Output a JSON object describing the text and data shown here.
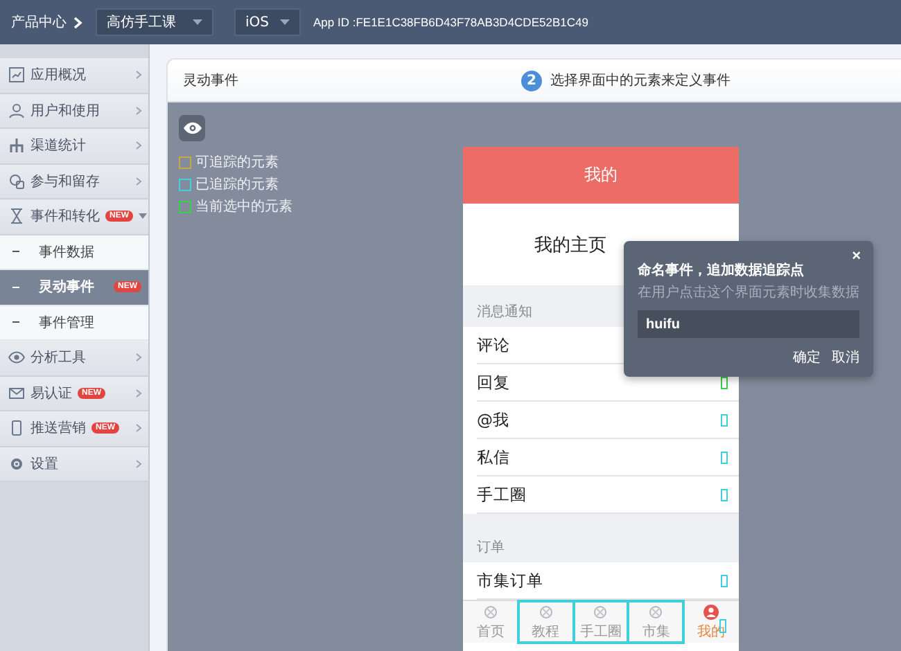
{
  "topbar": {
    "breadcrumb": "产品中心",
    "app_select": "高仿手工课",
    "platform_select": "iOS",
    "app_id": "App ID :FE1E1C38FB6D43F78AB3D4CDE52B1C49"
  },
  "sidebar": {
    "items": [
      {
        "label": "应用概况",
        "expanded": false
      },
      {
        "label": "用户和使用",
        "expanded": false
      },
      {
        "label": "渠道统计",
        "expanded": false
      },
      {
        "label": "参与和留存",
        "expanded": false
      },
      {
        "label": "事件和转化",
        "badge": "NEW",
        "expanded": true,
        "children": [
          {
            "label": "事件数据",
            "selected": false
          },
          {
            "label": "灵动事件",
            "badge": "NEW",
            "selected": true
          },
          {
            "label": "事件管理",
            "selected": false
          }
        ]
      },
      {
        "label": "分析工具",
        "expanded": false
      },
      {
        "label": "易认证",
        "badge": "NEW",
        "expanded": false
      },
      {
        "label": "推送营销",
        "badge": "NEW",
        "expanded": false
      },
      {
        "label": "设置",
        "expanded": false
      }
    ]
  },
  "main": {
    "title": "灵动事件",
    "step": {
      "number": "2",
      "text": "选择界面中的元素来定义事件"
    },
    "legend": [
      {
        "label": "可追踪的元素",
        "color": "#c9a441"
      },
      {
        "label": "已追踪的元素",
        "color": "#3fd0dc"
      },
      {
        "label": "当前选中的元素",
        "color": "#3ccf4a"
      }
    ],
    "phone": {
      "header_title": "我的",
      "profile_title": "我的主页",
      "sections": [
        {
          "title": "消息通知",
          "rows": [
            {
              "label": "评论"
            },
            {
              "label": "回复",
              "color": "#3ccf4a"
            },
            {
              "label": "@我",
              "color": "#3fd0dc"
            },
            {
              "label": "私信",
              "color": "#3fd0dc"
            },
            {
              "label": "手工圈",
              "color": "#3fd0dc"
            }
          ]
        },
        {
          "title": "订单",
          "rows": [
            {
              "label": "市集订单",
              "color": "#3fd0dc"
            }
          ]
        }
      ],
      "tabs": [
        {
          "label": "首页",
          "selected": false
        },
        {
          "label": "教程",
          "selected": false,
          "color": "#3fd0dc"
        },
        {
          "label": "手工圈",
          "selected": false,
          "color": "#3fd0dc"
        },
        {
          "label": "市集",
          "selected": false,
          "color": "#3fd0dc"
        },
        {
          "label": "我的",
          "selected": true,
          "color": "#3fd0dc"
        }
      ]
    },
    "dialog": {
      "title": "命名事件，追加数据追踪点",
      "subtitle": "在用户点击这个界面元素时收集数据",
      "close": "×",
      "input_value": "huifu",
      "buttons": [
        "确定",
        "取消"
      ]
    }
  }
}
